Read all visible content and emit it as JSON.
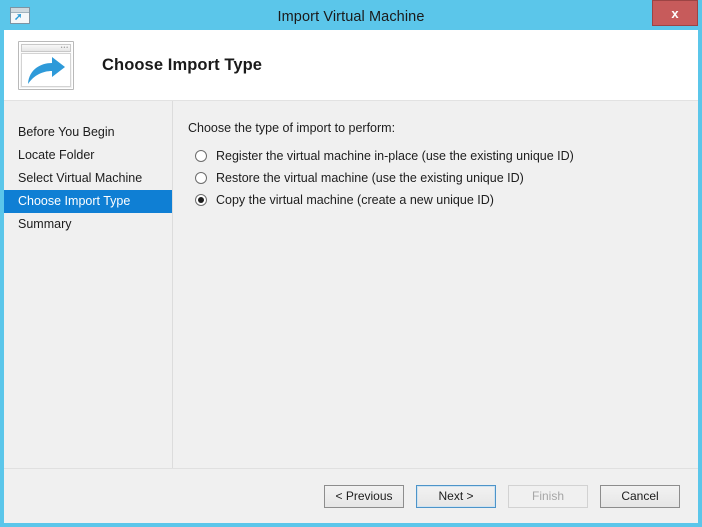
{
  "window": {
    "title": "Import Virtual Machine",
    "title_icon": "import-vm-icon",
    "close_label": "x",
    "accent_color": "#5bc6ea",
    "body_color": "#f0f0f0"
  },
  "header": {
    "icon": "import-arrow-window-icon",
    "title": "Choose Import Type"
  },
  "sidebar": {
    "items": [
      {
        "label": "Before You Begin",
        "selected": false
      },
      {
        "label": "Locate Folder",
        "selected": false
      },
      {
        "label": "Select Virtual Machine",
        "selected": false
      },
      {
        "label": "Choose Import Type",
        "selected": true
      },
      {
        "label": "Summary",
        "selected": false
      }
    ],
    "selected_color": "#0f7fd4"
  },
  "main": {
    "prompt": "Choose the type of import to perform:",
    "options": [
      {
        "label": "Register the virtual machine in-place (use the existing unique ID)",
        "checked": false
      },
      {
        "label": "Restore the virtual machine (use the existing unique ID)",
        "checked": false
      },
      {
        "label": "Copy the virtual machine (create a new unique ID)",
        "checked": true
      }
    ]
  },
  "footer": {
    "buttons": [
      {
        "label": "< Previous",
        "state": "normal"
      },
      {
        "label": "Next >",
        "state": "default"
      },
      {
        "label": "Finish",
        "state": "disabled"
      },
      {
        "label": "Cancel",
        "state": "normal"
      }
    ]
  }
}
